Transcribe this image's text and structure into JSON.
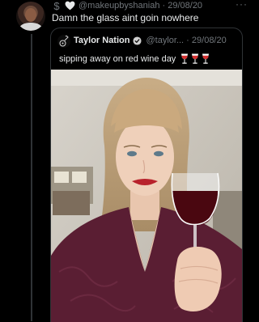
{
  "reply": {
    "handle": "@makeupbyshaniah",
    "separator": " · ",
    "date": "29/08/20",
    "text": "Damn the glass aint goin nowhere",
    "more": "···"
  },
  "quote": {
    "name": "Taylor Nation",
    "handle": "@taylor...",
    "separator": " · ",
    "date": "29/08/20",
    "text": "sipping away on red wine day"
  },
  "colors": {
    "background": "#000000",
    "text": "#e7e9ea",
    "muted": "#71767b",
    "border": "#2f3336",
    "verified": "#cfcfcf",
    "wine": "#d32f2f"
  },
  "icons": [
    "dollar-icon",
    "heart-icon",
    "more-icon",
    "verified-icon",
    "wine-glass-icon"
  ]
}
